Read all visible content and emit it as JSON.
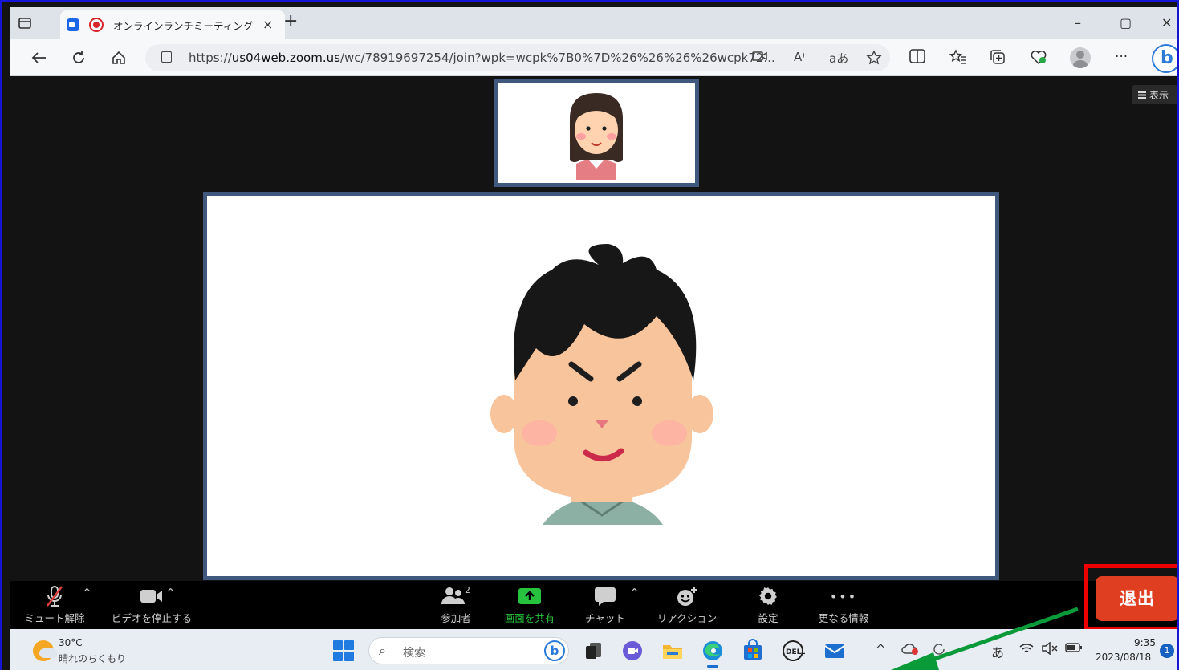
{
  "browser": {
    "tab_title": "オンラインランチミーティング",
    "tab_close": "×",
    "new_tab": "+",
    "url_prefix": "https://",
    "url_host": "us04web.zoom.us",
    "url_path": "/wc/78919697254/join?wpk=wcpk%7B0%7D%26%26%26%26wcpk72...",
    "read_aloud": "A⁾",
    "translate": "aあ",
    "more": "···",
    "window_controls": [
      "–",
      "▢",
      "✕"
    ]
  },
  "meeting": {
    "view_label": "表示"
  },
  "zoom_toolbar": {
    "mute": "ミュート解除",
    "video": "ビデオを停止する",
    "participants": "参加者",
    "participants_count": "2",
    "share": "画面を共有",
    "chat": "チャット",
    "reactions": "リアクション",
    "settings": "設定",
    "more": "更なる情報",
    "more_dots": "•••",
    "leave": "退出",
    "caret": "^"
  },
  "taskbar": {
    "temperature": "30°C",
    "weather": "晴れのちくもり",
    "search_placeholder": "検索",
    "search_bing": "b",
    "ime": "あ",
    "time": "9:35",
    "date": "2023/08/18",
    "notifications": "1"
  },
  "colors": {
    "frame_border": "#1515d6",
    "leave_button": "#e03e21",
    "leave_highlight": "#ee0000",
    "share_green": "#27c33f",
    "tile_border": "#40587e",
    "arrow_green": "#0a9a3a"
  }
}
